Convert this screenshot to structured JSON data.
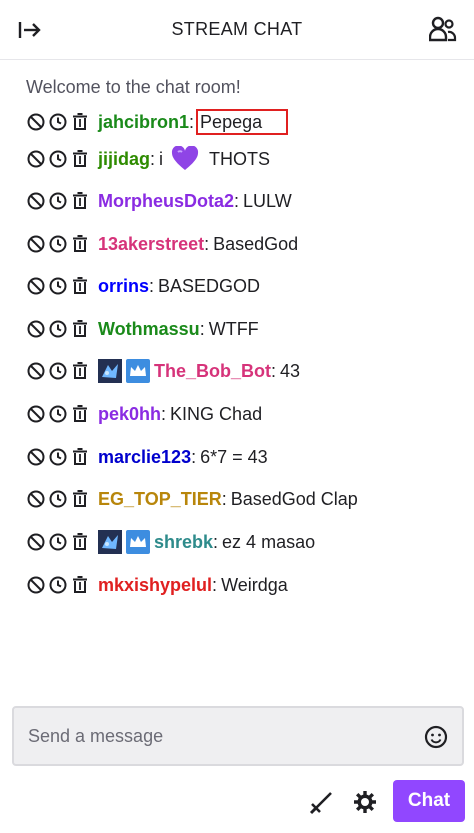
{
  "header": {
    "title": "STREAM CHAT"
  },
  "welcome": "Welcome to the chat room!",
  "messages": [
    {
      "user": "jahcibron1",
      "color": "#1a8a1a",
      "text": "Pepega",
      "highlighted": true,
      "badges": []
    },
    {
      "user": "jijidag",
      "color": "#2e8b00",
      "text_before": "i",
      "emote": "heart",
      "text": "THOTS",
      "badges": []
    },
    {
      "user": "MorpheusDota2",
      "color": "#8a2be2",
      "text": "LULW",
      "badges": []
    },
    {
      "user": "13akerstreet",
      "color": "#d6337a",
      "text": "BasedGod",
      "badges": []
    },
    {
      "user": "orrins",
      "color": "#0000ff",
      "text": "BASEDGOD",
      "badges": []
    },
    {
      "user": "Wothmassu",
      "color": "#1a8a1a",
      "text": "WTFF",
      "badges": []
    },
    {
      "user": "The_Bob_Bot",
      "color": "#d6337a",
      "text": "43",
      "badges": [
        "emote-badge",
        "crown-badge"
      ]
    },
    {
      "user": "pek0hh",
      "color": "#8a2be2",
      "text": "KING Chad",
      "badges": []
    },
    {
      "user": "marclie123",
      "color": "#0000cd",
      "text": "6*7 = 43",
      "badges": []
    },
    {
      "user": "EG_TOP_TIER",
      "color": "#b8860b",
      "text": "BasedGod Clap",
      "badges": []
    },
    {
      "user": "shrebk",
      "color": "#2e8b8b",
      "text": "ez 4 masao",
      "badges": [
        "emote-badge",
        "crown-badge"
      ]
    },
    {
      "user": "mkxishypelul",
      "color": "#e02020",
      "text": "Weirdga",
      "badges": []
    }
  ],
  "input": {
    "placeholder": "Send a message"
  },
  "chat_button": "Chat"
}
